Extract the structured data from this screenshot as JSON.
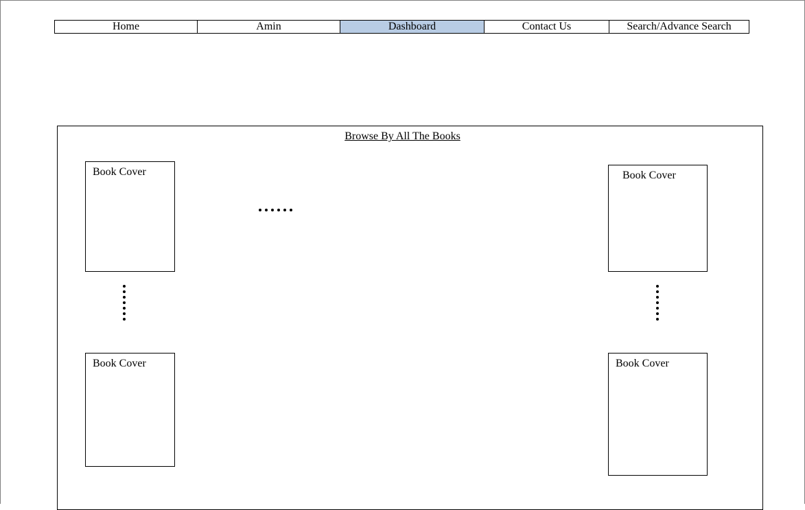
{
  "nav": {
    "items": [
      {
        "label": "Home",
        "active": false
      },
      {
        "label": "Amin",
        "active": false
      },
      {
        "label": "Dashboard",
        "active": true
      },
      {
        "label": "Contact Us",
        "active": false
      },
      {
        "label": "Search/Advance Search",
        "active": false
      }
    ],
    "active_color": "#b8cce4"
  },
  "browse": {
    "title": "Browse By All The Books",
    "books": [
      {
        "label": "Book Cover"
      },
      {
        "label": "Book Cover"
      },
      {
        "label": "Book Cover"
      },
      {
        "label": "Book Cover"
      }
    ]
  }
}
